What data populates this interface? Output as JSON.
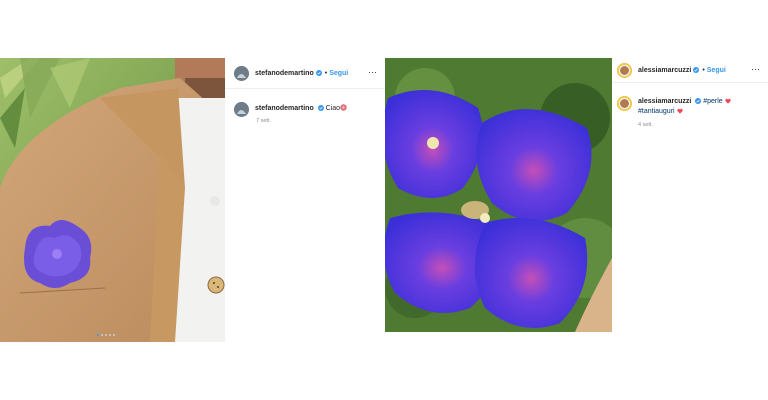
{
  "post1": {
    "username": "stefanodemartino",
    "follow_label": "Segui",
    "separator": "•",
    "more_label": "···",
    "caption_user": "stefanodemartino",
    "caption_text": "Ciao",
    "time": "7 sett.",
    "carousel_count": 5,
    "carousel_active": 0
  },
  "post2": {
    "username": "alessiamarcuzzi",
    "follow_label": "Segui",
    "separator": "•",
    "more_label": "···",
    "caption_user": "alessiamarcuzzi",
    "caption_tag1": "#perle",
    "caption_tag2": "#tantiauguri",
    "time": "4 sett."
  },
  "colors": {
    "accent_blue": "#3897f0",
    "heart_red": "#ed4956"
  }
}
